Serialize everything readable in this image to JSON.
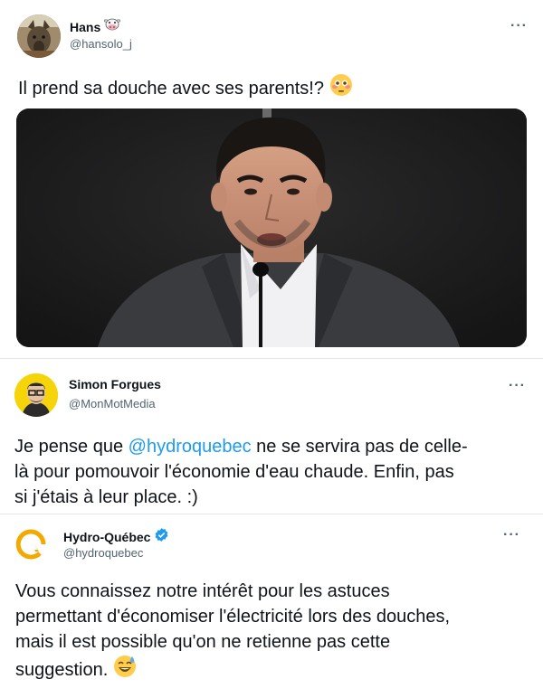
{
  "tweet1": {
    "name": "Hans",
    "name_emoji": "cow-face-icon",
    "handle": "@hansolo_j",
    "text": "Il prend sa douche avec ses parents!?",
    "text_emoji": "flushed-face-icon"
  },
  "tweet2": {
    "name": "Simon Forgues",
    "handle": "@MonMotMedia",
    "text_line1_pre": "Je pense que ",
    "mention": "@hydroquebec",
    "text_line1_post": " ne se servira pas de celle-",
    "text_line2": "là pour pomouvoir l'économie d'eau chaude. Enfin, pas",
    "text_line3": "si j'étais à leur place. :)"
  },
  "tweet3": {
    "name": "Hydro-Québec",
    "verified": "verified-badge-icon",
    "handle": "@hydroquebec",
    "text_line1": "Vous connaissez notre intérêt pour les astuces",
    "text_line2": "permettant d'économiser l'électricité lors des douches,",
    "text_line3": "mais il est possible qu'on ne retienne pas cette",
    "text_line4": "suggestion.",
    "text_emoji": "sweat-smile-icon"
  },
  "more_label": "···",
  "colors": {
    "link": "#1d9bf0",
    "brand": "#f2a900",
    "verified": "#1d9bf0"
  }
}
